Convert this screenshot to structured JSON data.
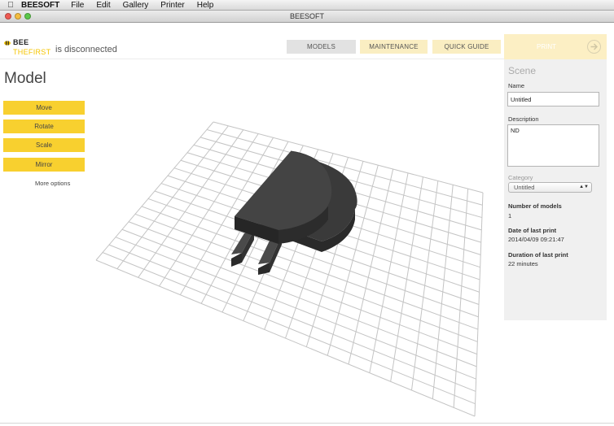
{
  "menubar": {
    "app": "BEESOFT",
    "items": [
      "File",
      "Edit",
      "Gallery",
      "Printer",
      "Help"
    ]
  },
  "window": {
    "title": "BEESOFT"
  },
  "header": {
    "logo_top": "BEE",
    "logo_bottom": "THEFIRST",
    "status": "is disconnected",
    "nav": {
      "models": "MODELS",
      "maintenance": "MAINTENANCE",
      "quick_guide": "QUICK GUIDE"
    }
  },
  "print_button": {
    "label": "PRINT"
  },
  "left_panel": {
    "title": "Model",
    "tools": [
      "Move",
      "Rotate",
      "Scale",
      "Mirror"
    ],
    "more_options": "More options"
  },
  "scene": {
    "heading": "Scene",
    "name_label": "Name",
    "name_value": "Untitled",
    "description_label": "Description",
    "description_value": "ND",
    "category_label": "Category",
    "category_value": "Untitled",
    "num_models_label": "Number of models",
    "num_models_value": "1",
    "date_label": "Date of last print",
    "date_value": "2014/04/09 09:21:47",
    "duration_label": "Duration of last print",
    "duration_value": "22 minutes"
  },
  "colors": {
    "accent": "#f8d02f",
    "nav_inactive": "#faeec2",
    "nav_active": "#e2e2e2",
    "model": "#3b3b3b"
  }
}
